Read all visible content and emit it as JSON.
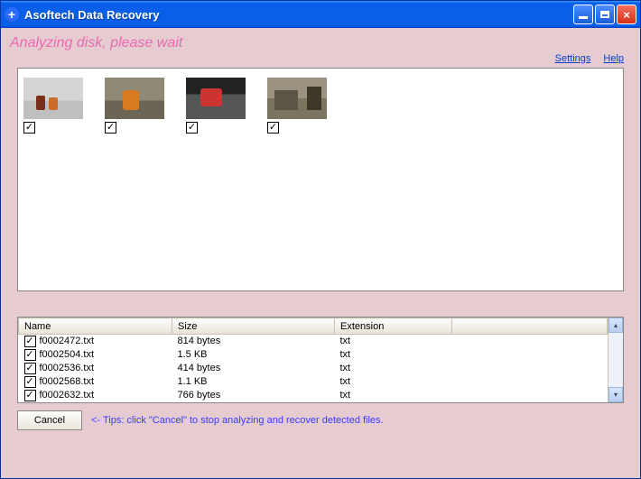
{
  "window": {
    "title": "Asoftech Data Recovery"
  },
  "status": "Analyzing disk, please wait",
  "links": {
    "settings": "Settings",
    "help": "Help"
  },
  "columns": {
    "name": "Name",
    "size": "Size",
    "extension": "Extension"
  },
  "files": [
    {
      "name": "f0002472.txt",
      "size": "814 bytes",
      "ext": "txt"
    },
    {
      "name": "f0002504.txt",
      "size": "1.5 KB",
      "ext": "txt"
    },
    {
      "name": "f0002536.txt",
      "size": "414 bytes",
      "ext": "txt"
    },
    {
      "name": "f0002568.txt",
      "size": "1.1 KB",
      "ext": "txt"
    },
    {
      "name": "f0002632.txt",
      "size": "766 bytes",
      "ext": "txt"
    }
  ],
  "buttons": {
    "cancel": "Cancel"
  },
  "tip": "<- Tips: click \"Cancel\" to stop analyzing and recover detected files."
}
